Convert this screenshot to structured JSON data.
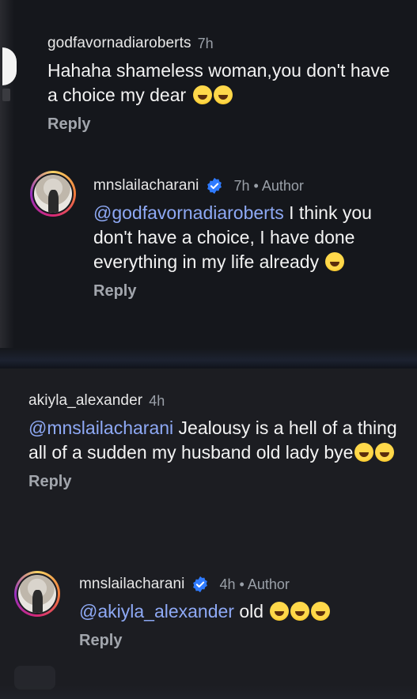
{
  "thread_top": {
    "comment1": {
      "username": "godfavornadiaroberts",
      "time": "7h",
      "text": "Hahaha shameless woman,you don't have a choice my dear",
      "emojis": [
        "joy-face",
        "joy-face"
      ],
      "reply_label": "Reply"
    },
    "reply1": {
      "username": "mnslailacharani",
      "time_author": "7h • Author",
      "mention": "@godfavornadiaroberts",
      "text": " I think you don't have a choice, I have done everything in my life already",
      "emojis": [
        "rofl-face"
      ],
      "reply_label": "Reply"
    }
  },
  "thread_bottom": {
    "comment2": {
      "username": "akiyla_alexander",
      "time": "4h",
      "mention": "@mnslailacharani",
      "text": " Jealousy is a hell of a thing all of a sudden my husband old lady bye",
      "emojis": [
        "joy-face",
        "joy-face"
      ],
      "reply_label": "Reply"
    },
    "reply2": {
      "username": "mnslailacharani",
      "time_author": "4h • Author",
      "mention": "@akiyla_alexander",
      "text": " old ",
      "emojis": [
        "rofl-face",
        "rofl-face",
        "rofl-face"
      ],
      "reply_label": "Reply"
    }
  },
  "colors": {
    "mention": "#8ea9f5",
    "verified": "#2f7bff",
    "background": "#15171c"
  }
}
